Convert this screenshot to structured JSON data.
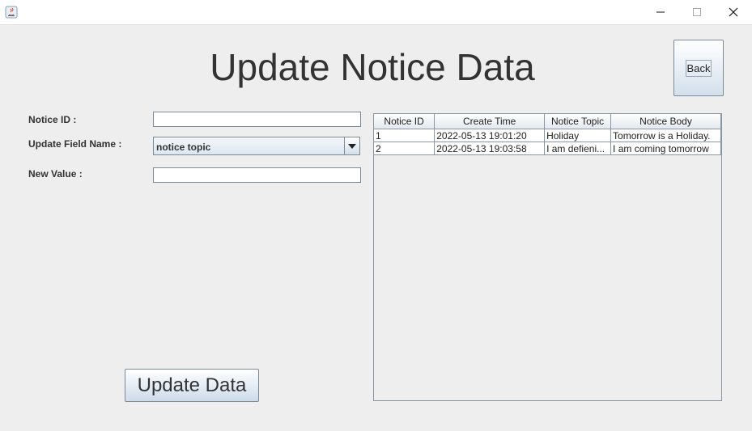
{
  "window": {
    "icon": "java-icon",
    "controls": {
      "minimize": "minimize-icon",
      "maximize": "maximize-icon",
      "close": "close-icon"
    }
  },
  "heading": "Update Notice Data",
  "back_button": "Back",
  "form": {
    "notice_id_label": "Notice ID :",
    "notice_id_value": "",
    "field_name_label": "Update Field Name :",
    "field_name_value": "notice topic",
    "new_value_label": "New Value :",
    "new_value_value": ""
  },
  "update_button": "Update Data",
  "table": {
    "columns": [
      "Notice ID",
      "Create Time",
      "Notice Topic",
      "Notice Body"
    ],
    "rows": [
      [
        "1",
        "2022-05-13 19:01:20",
        "Holiday",
        "Tomorrow is a Holiday."
      ],
      [
        "2",
        "2022-05-13 19:03:58",
        "I am defieni...",
        "I am coming tomorrow"
      ]
    ]
  },
  "colors": {
    "accent": "#d3dfec",
    "border": "#7a8a99",
    "background": "#eeeeee"
  }
}
